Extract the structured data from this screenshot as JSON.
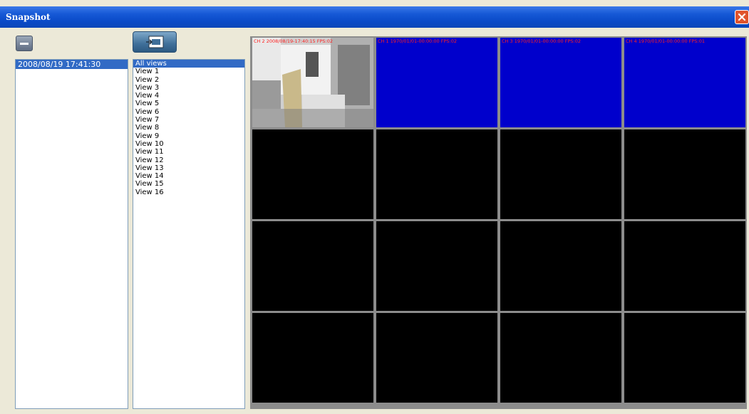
{
  "window": {
    "title": "Snapshot"
  },
  "snapshot_list": {
    "items": [
      "2008/08/19 17:41:30"
    ],
    "selected_index": 0
  },
  "view_list": {
    "items": [
      "All views",
      "View 1",
      "View 2",
      "View 3",
      "View 4",
      "View 5",
      "View 6",
      "View 7",
      "View 8",
      "View 9",
      "View 10",
      "View 11",
      "View 12",
      "View 13",
      "View 14",
      "View 15",
      "View 16"
    ],
    "selected_index": 0
  },
  "grid": {
    "cells": [
      {
        "osd": "CH 2 2008/08/19-17:40:15 FPS:02",
        "kind": "image"
      },
      {
        "osd": "CH 1 1970/01/01-00:00:00 FPS:02",
        "kind": "blue"
      },
      {
        "osd": "CH 3 1970/01/01-00:00:00 FPS:02",
        "kind": "blue"
      },
      {
        "osd": "CH 4 1970/01/01-00:00:00 FPS:01",
        "kind": "blue"
      },
      {
        "osd": "",
        "kind": "black"
      },
      {
        "osd": "",
        "kind": "black"
      },
      {
        "osd": "",
        "kind": "black"
      },
      {
        "osd": "",
        "kind": "black"
      },
      {
        "osd": "",
        "kind": "black"
      },
      {
        "osd": "",
        "kind": "black"
      },
      {
        "osd": "",
        "kind": "black"
      },
      {
        "osd": "",
        "kind": "black"
      },
      {
        "osd": "",
        "kind": "black"
      },
      {
        "osd": "",
        "kind": "black"
      },
      {
        "osd": "",
        "kind": "black"
      },
      {
        "osd": "",
        "kind": "black"
      }
    ]
  },
  "colors": {
    "title_bar": "#0b52d6",
    "selection": "#316ac5",
    "video_blue": "#0000cc",
    "osd_text": "#ff2020"
  },
  "icons": {
    "close": "close-icon",
    "remove": "minus-icon",
    "export": "export-icon"
  }
}
